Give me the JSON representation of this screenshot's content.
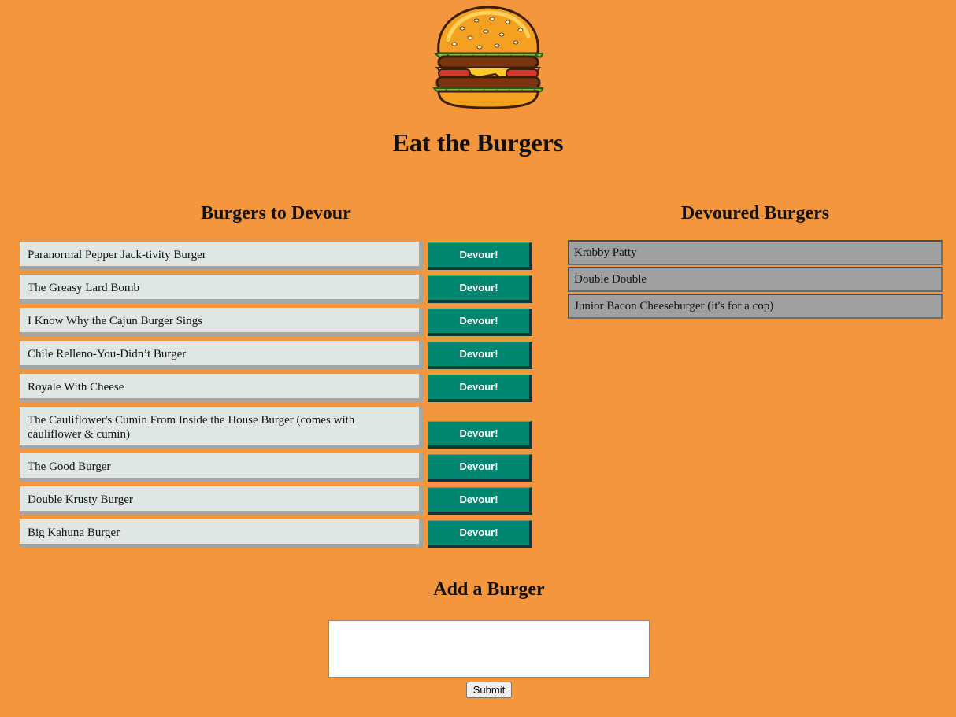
{
  "header": {
    "title": "Eat the Burgers",
    "logo_icon": "burger-icon"
  },
  "to_devour": {
    "heading": "Burgers to Devour",
    "button_label": "Devour!",
    "items": [
      {
        "name": "Paranormal Pepper Jack-tivity Burger"
      },
      {
        "name": "The Greasy Lard Bomb"
      },
      {
        "name": "I Know Why the Cajun Burger Sings"
      },
      {
        "name": "Chile Relleno-You-Didn’t Burger"
      },
      {
        "name": "Royale With Cheese"
      },
      {
        "name": "The Cauliflower's Cumin From Inside the House Burger (comes with cauliflower & cumin)"
      },
      {
        "name": "The Good Burger"
      },
      {
        "name": "Double Krusty Burger"
      },
      {
        "name": "Big Kahuna Burger"
      }
    ]
  },
  "devoured": {
    "heading": "Devoured Burgers",
    "items": [
      {
        "name": "Krabby Patty"
      },
      {
        "name": "Double Double"
      },
      {
        "name": "Junior Bacon Cheeseburger (it's for a cop)"
      }
    ]
  },
  "add_form": {
    "heading": "Add a Burger",
    "input_value": "",
    "submit_label": "Submit"
  },
  "colors": {
    "background": "#f3963e",
    "devour_button": "#00876f",
    "pending_item": "#e0e6e3",
    "devoured_item": "#a0a0a0"
  }
}
